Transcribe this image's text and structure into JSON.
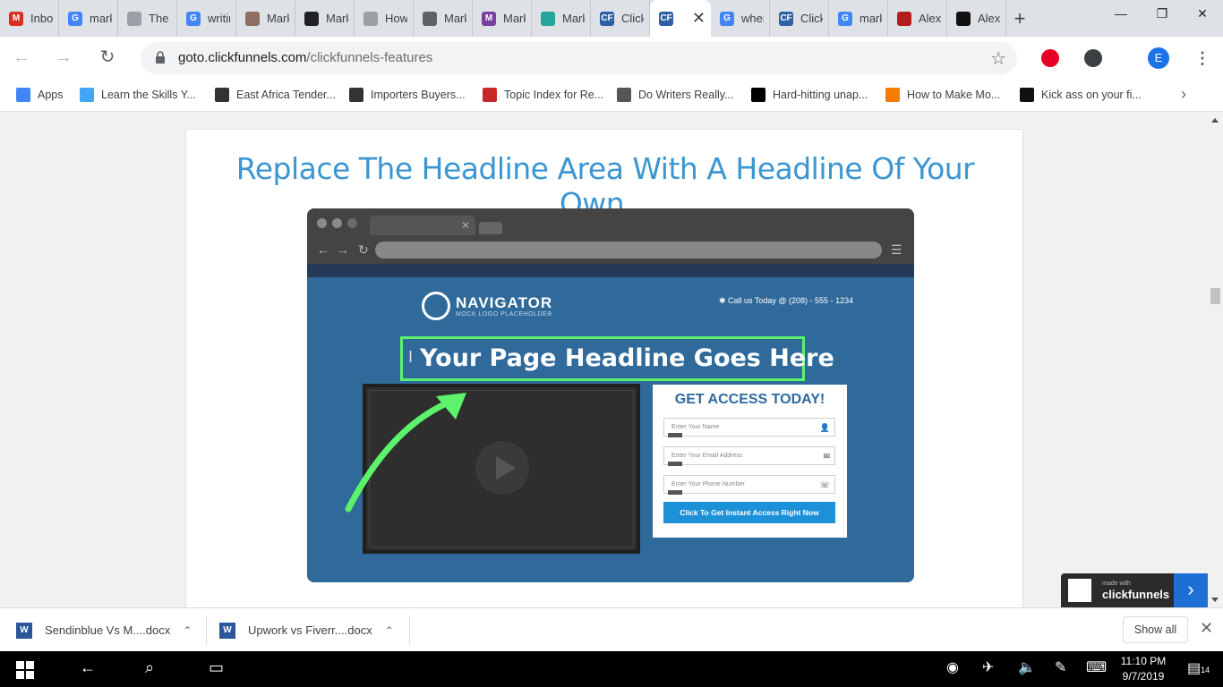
{
  "tabs": [
    {
      "title": "Inbo",
      "fav": "gmail-icon",
      "color": "#d93025",
      "glyph": "M"
    },
    {
      "title": "mark",
      "fav": "google-icon",
      "color": "#4285f4",
      "glyph": "G"
    },
    {
      "title": "The I",
      "fav": "page-icon",
      "color": "#9aa0a6",
      "glyph": ""
    },
    {
      "title": "writir",
      "fav": "google-icon",
      "color": "#4285f4",
      "glyph": "G"
    },
    {
      "title": "Mark",
      "fav": "target-icon",
      "color": "#8d6e63",
      "glyph": ""
    },
    {
      "title": "Mark",
      "fav": "circle-icon",
      "color": "#202124",
      "glyph": ""
    },
    {
      "title": "How",
      "fav": "page-icon",
      "color": "#9aa0a6",
      "glyph": ""
    },
    {
      "title": "Mark",
      "fav": "globe-icon",
      "color": "#5f6368",
      "glyph": ""
    },
    {
      "title": "Mark",
      "fav": "m-icon",
      "color": "#7b3fa0",
      "glyph": "M"
    },
    {
      "title": "Mark",
      "fav": "leaf-icon",
      "color": "#26a69a",
      "glyph": ""
    },
    {
      "title": "Click",
      "fav": "clickfunnels-icon",
      "color": "#2f5fa5",
      "glyph": "CF"
    },
    {
      "title": "",
      "fav": "clickfunnels-icon",
      "color": "#2f5fa5",
      "glyph": "CF",
      "active": true
    },
    {
      "title": "wher",
      "fav": "google-icon",
      "color": "#4285f4",
      "glyph": "G"
    },
    {
      "title": "Click",
      "fav": "clickfunnels-icon",
      "color": "#2f5fa5",
      "glyph": "CF"
    },
    {
      "title": "mark",
      "fav": "google-icon",
      "color": "#4285f4",
      "glyph": "G"
    },
    {
      "title": "Alex",
      "fav": "avatar-icon",
      "color": "#b71c1c",
      "glyph": ""
    },
    {
      "title": "Alex",
      "fav": "dark-icon",
      "color": "#111111",
      "glyph": ""
    }
  ],
  "new_tab": "+",
  "address": {
    "host": "goto.clickfunnels.com",
    "path": "/clickfunnels-features"
  },
  "profile_initial": "E",
  "bookmarks": [
    {
      "label": "Apps",
      "icon": "apps-grid-icon",
      "color": "#4285f4"
    },
    {
      "label": "Learn the Skills Y...",
      "icon": "learn-icon",
      "color": "#42a5f5"
    },
    {
      "label": "East Africa Tender...",
      "icon": "tender-icon",
      "color": "#333333"
    },
    {
      "label": "Importers Buyers...",
      "icon": "importers-icon",
      "color": "#333333"
    },
    {
      "label": "Topic Index for Re...",
      "icon": "topic-icon",
      "color": "#c62828"
    },
    {
      "label": "Do Writers Really...",
      "icon": "clock-icon",
      "color": "#555555"
    },
    {
      "label": "Hard-hitting unap...",
      "icon": "medium-icon",
      "color": "#000000"
    },
    {
      "label": "How to Make Mo...",
      "icon": "mp-icon",
      "color": "#f57c00"
    },
    {
      "label": "Kick ass on your fi...",
      "icon": "kick-icon",
      "color": "#111111"
    }
  ],
  "page": {
    "headline": "Replace The Headline Area With A Headline Of Your Own...",
    "mock": {
      "logo_name": "NAVIGATOR",
      "logo_sub": "MOCK LOGO PLACEHOLDER",
      "call": "✱ Call us Today @ (208) - 555 - 1234",
      "headline": "Your Page Headline Goes Here",
      "form_title": "GET ACCESS TODAY!",
      "name_placeholder": "Enter Your Name",
      "email_placeholder": "Enter Your Email Address",
      "phone_placeholder": "Enter Your Phone Number",
      "cta": "Click To Get Instant Access Right Now"
    },
    "badge_small": "made with",
    "badge_big": "clickfunnels"
  },
  "downloads": [
    {
      "name": "Sendinblue Vs M....docx"
    },
    {
      "name": "Upwork vs Fiverr....docx"
    }
  ],
  "show_all": "Show all",
  "clock": {
    "time": "11:10 PM",
    "date": "9/7/2019"
  },
  "notifications": "14"
}
